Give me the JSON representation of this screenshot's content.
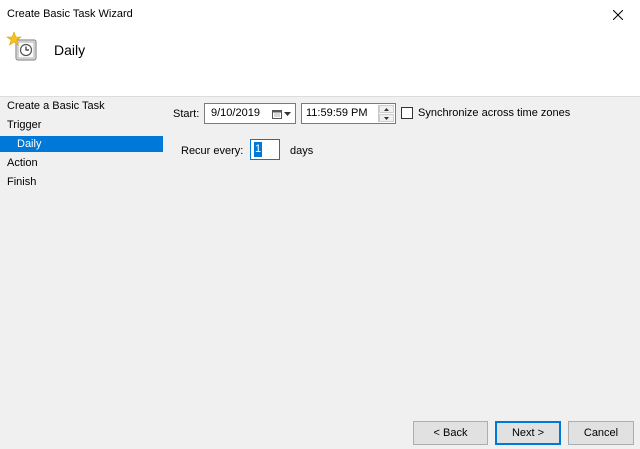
{
  "window": {
    "title": "Create Basic Task Wizard"
  },
  "header": {
    "title": "Daily"
  },
  "nav": {
    "items": [
      {
        "label": "Create a Basic Task"
      },
      {
        "label": "Trigger"
      },
      {
        "label": "Daily",
        "selected": true,
        "indent": true
      },
      {
        "label": "Action"
      },
      {
        "label": "Finish"
      }
    ]
  },
  "form": {
    "start_label": "Start:",
    "date_value": "9/10/2019",
    "time_value": "11:59:59 PM",
    "sync_label": "Synchronize across time zones",
    "sync_checked": false,
    "recur_label": "Recur every:",
    "recur_value": "1",
    "recur_unit": "days"
  },
  "buttons": {
    "back": "< Back",
    "next": "Next >",
    "cancel": "Cancel"
  },
  "colors": {
    "accent": "#0078d7",
    "background": "#f0f0f0",
    "header_background": "#ffffff"
  }
}
